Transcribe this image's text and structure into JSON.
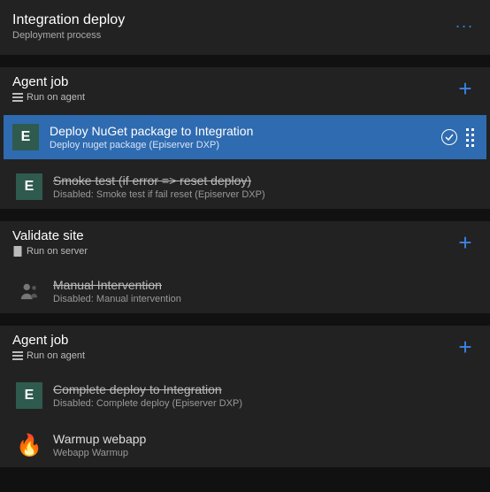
{
  "header": {
    "title": "Integration deploy",
    "subtitle": "Deployment process",
    "more": "..."
  },
  "sections": [
    {
      "title": "Agent job",
      "sub": "Run on agent",
      "sub_icon": "list",
      "tasks": [
        {
          "icon": "E",
          "title": "Deploy NuGet package to Integration",
          "sub": "Deploy nuget package (Episerver DXP)",
          "selected": true,
          "disabled": false
        },
        {
          "icon": "E",
          "title": "Smoke test (if error => reset deploy)",
          "sub": "Disabled: Smoke test if fail reset (Episerver DXP)",
          "selected": false,
          "disabled": true
        }
      ]
    },
    {
      "title": "Validate site",
      "sub": "Run on server",
      "sub_icon": "server",
      "tasks": [
        {
          "icon": "person",
          "title": "Manual Intervention",
          "sub": "Disabled: Manual intervention",
          "selected": false,
          "disabled": true
        }
      ]
    },
    {
      "title": "Agent job",
      "sub": "Run on agent",
      "sub_icon": "list",
      "tasks": [
        {
          "icon": "E",
          "title": "Complete deploy to Integration",
          "sub": "Disabled: Complete deploy (Episerver DXP)",
          "selected": false,
          "disabled": true
        },
        {
          "icon": "flame",
          "title": "Warmup webapp",
          "sub": "Webapp Warmup",
          "selected": false,
          "disabled": false
        }
      ]
    }
  ]
}
